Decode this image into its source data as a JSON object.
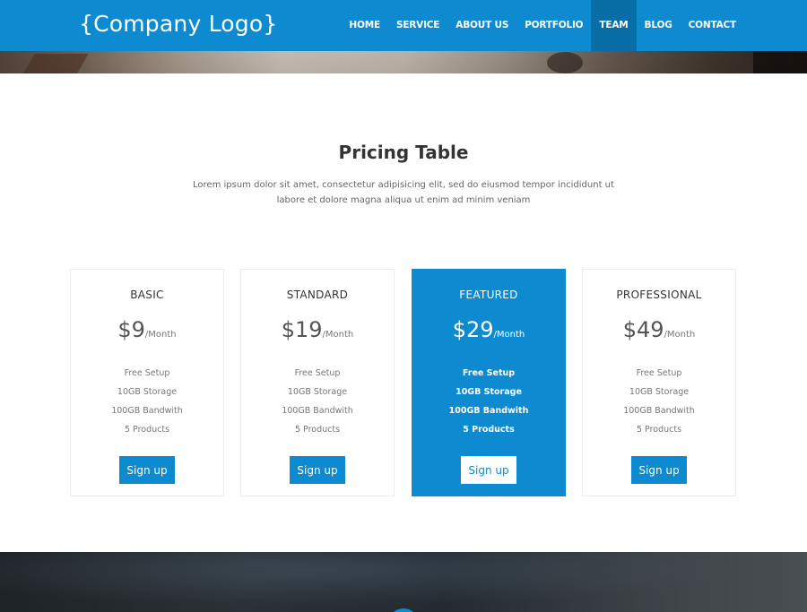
{
  "header": {
    "logo": "{Company Logo}",
    "nav": [
      {
        "label": "HOME"
      },
      {
        "label": "SERVICE"
      },
      {
        "label": "ABOUT US"
      },
      {
        "label": "PORTFOLIO"
      },
      {
        "label": "TEAM",
        "active": true
      },
      {
        "label": "BLOG"
      },
      {
        "label": "CONTACT"
      }
    ]
  },
  "pricing": {
    "title": "Pricing Table",
    "description": "Lorem ipsum dolor sit amet, consectetur adipisicing elit, sed do eiusmod tempor incididunt ut labore et dolore magna aliqua ut enim ad minim veniam",
    "plans": [
      {
        "name": "BASIC",
        "price": "$9",
        "period": "/Month",
        "features": [
          "Free Setup",
          "10GB Storage",
          "100GB Bandwith",
          "5 Products"
        ],
        "button": "Sign up"
      },
      {
        "name": "STANDARD",
        "price": "$19",
        "period": "/Month",
        "features": [
          "Free Setup",
          "10GB Storage",
          "100GB Bandwith",
          "5 Products"
        ],
        "button": "Sign up"
      },
      {
        "name": "FEATURED",
        "price": "$29",
        "period": "/Month",
        "features": [
          "Free Setup",
          "10GB Storage",
          "100GB Bandwith",
          "5 Products"
        ],
        "button": "Sign up",
        "featured": true
      },
      {
        "name": "PROFESSIONAL",
        "price": "$49",
        "period": "/Month",
        "features": [
          "Free Setup",
          "10GB Storage",
          "100GB Bandwith",
          "5 Products"
        ],
        "button": "Sign up"
      }
    ]
  },
  "colors": {
    "accent": "#0e8bd0",
    "nav_active": "#0a6ea6"
  }
}
